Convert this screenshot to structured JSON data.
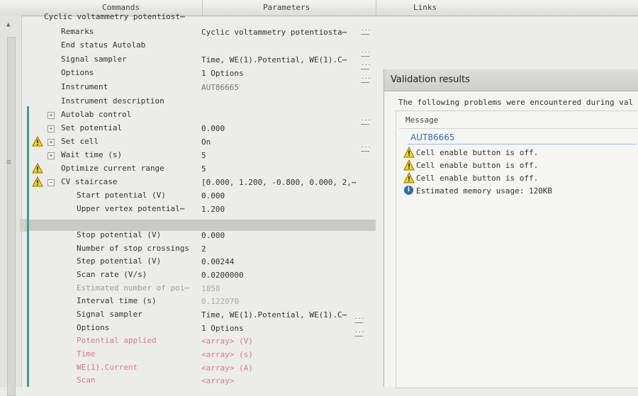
{
  "header": {
    "commands": "Commands",
    "parameters": "Parameters",
    "links": "Links"
  },
  "tree": {
    "root": "Cyclic voltammetry potentiost⋯",
    "rows": [
      {
        "name": "Remarks",
        "value": "Cyclic voltammetry potentiosta⋯"
      },
      {
        "name": "End status Autolab",
        "value": ""
      },
      {
        "name": "Signal sampler",
        "value": "Time, WE(1).Potential, WE(1).C⋯"
      },
      {
        "name": "Options",
        "value": "1 Options"
      },
      {
        "name": "Instrument",
        "value": "AUT86665"
      },
      {
        "name": "Instrument description",
        "value": ""
      },
      {
        "name": "Autolab control",
        "value": ""
      },
      {
        "name": "Set potential",
        "value": "0.000"
      },
      {
        "name": "Set cell",
        "value": "On"
      },
      {
        "name": "Wait time (s)",
        "value": "5"
      },
      {
        "name": "Optimize current range",
        "value": "5"
      },
      {
        "name": "CV staircase",
        "value": "[0.000, 1.200, -0.800, 0.000, 2,⋯"
      },
      {
        "name": "Start potential (V)",
        "value": "0.000"
      },
      {
        "name": "Upper vertex potential⋯",
        "value": "1.200"
      },
      {
        "name": "Stop potential (V)",
        "value": "0.000"
      },
      {
        "name": "Number of stop crossings",
        "value": "2"
      },
      {
        "name": "Step potential (V)",
        "value": "0.00244"
      },
      {
        "name": "Scan rate (V/s)",
        "value": "0.0200000"
      },
      {
        "name": "Estimated number of poi⋯",
        "value": "1850"
      },
      {
        "name": "Interval time (s)",
        "value": "0.122070"
      },
      {
        "name": "Signal sampler",
        "value": "Time, WE(1).Potential, WE(1).C⋯"
      },
      {
        "name": "Options",
        "value": "1 Options"
      },
      {
        "name": "Potential applied",
        "value": "<array> (V)"
      },
      {
        "name": "Time",
        "value": "<array> (s)"
      },
      {
        "name": "WE(1).Current",
        "value": "<array> (A)"
      },
      {
        "name": "Scan",
        "value": "<array>"
      }
    ]
  },
  "dialog": {
    "title": "Validation results",
    "intro": "The following problems were encountered during val",
    "column": "Message",
    "group": "AUT86665",
    "messages": [
      {
        "icon": "warning-icon",
        "text": "Cell enable button is off."
      },
      {
        "icon": "warning-icon",
        "text": "Cell enable button is off."
      },
      {
        "icon": "warning-icon",
        "text": "Cell enable button is off."
      },
      {
        "icon": "info-icon",
        "text": "Estimated memory usage: 120KB"
      }
    ]
  },
  "colors": {
    "accent_green": "#3aa08a",
    "warning_yellow": "#f2d21b",
    "info_blue": "#2e6db4",
    "group_blue": "#2d6fb5",
    "disabled_pink": "#d77a8c"
  }
}
